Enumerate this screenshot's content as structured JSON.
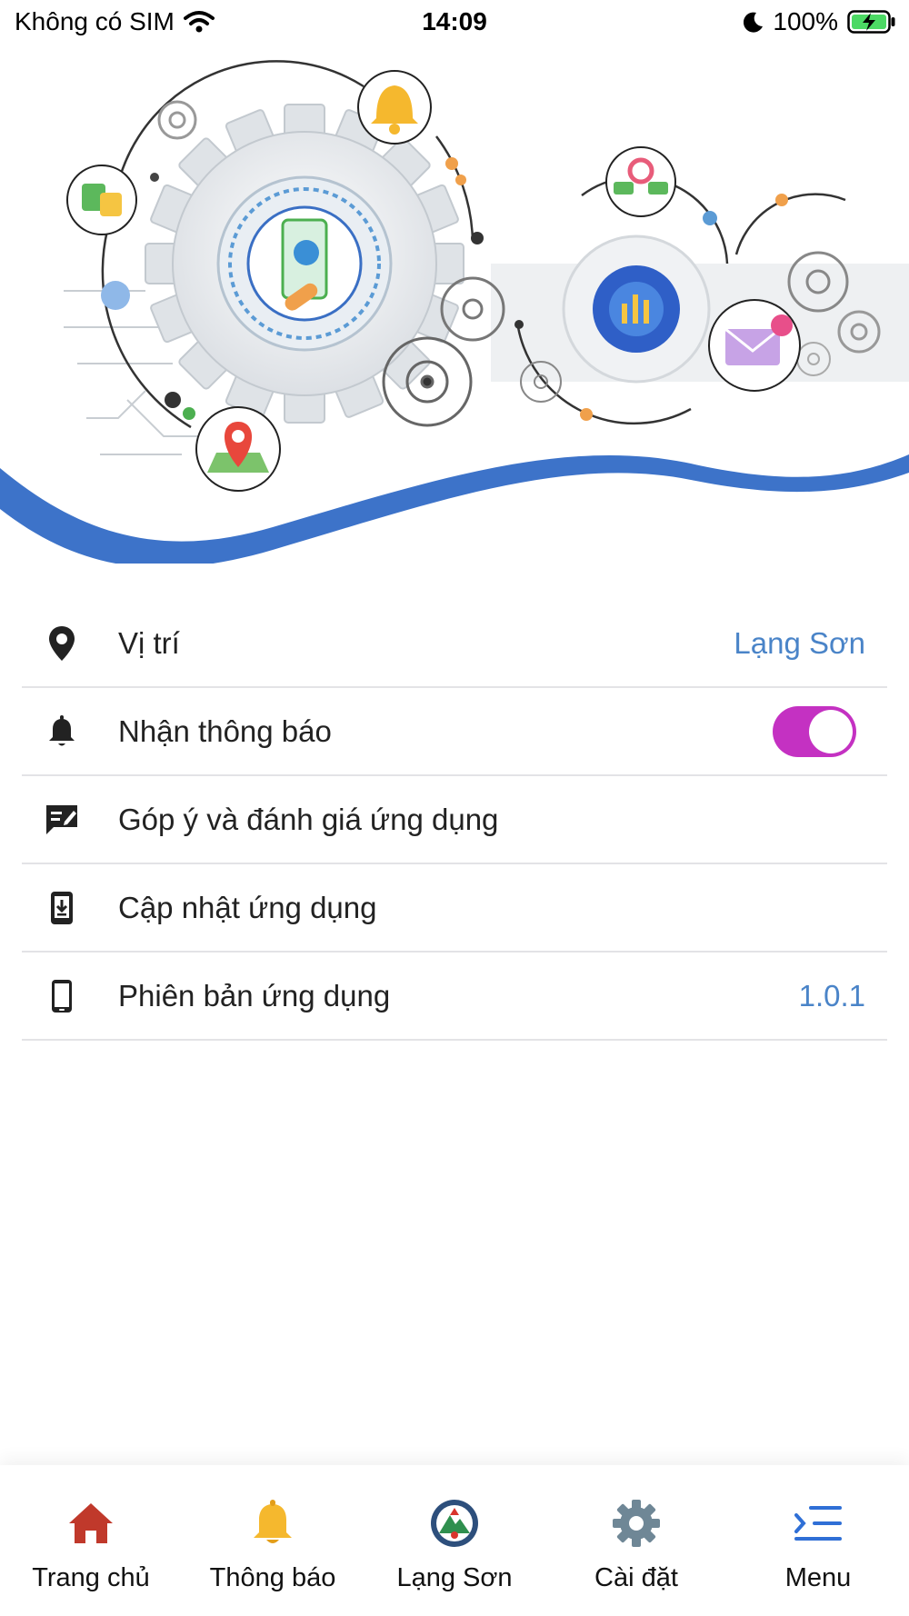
{
  "status_bar": {
    "carrier": "Không có SIM",
    "time": "14:09",
    "battery": "100%"
  },
  "settings": {
    "items": [
      {
        "label": "Vị trí",
        "value": "Lạng Sơn",
        "icon": "location-pin-icon"
      },
      {
        "label": "Nhận thông báo",
        "toggle_on": true,
        "icon": "bell-icon"
      },
      {
        "label": "Góp ý và đánh giá ứng dụng",
        "icon": "feedback-icon"
      },
      {
        "label": "Cập nhật ứng dụng",
        "icon": "download-update-icon"
      },
      {
        "label": "Phiên bản ứng dụng",
        "value": "1.0.1",
        "icon": "phone-icon"
      }
    ]
  },
  "tab_bar": {
    "items": [
      {
        "label": "Trang chủ",
        "icon": "home-icon"
      },
      {
        "label": "Thông báo",
        "icon": "bell-icon"
      },
      {
        "label": "Lạng Sơn",
        "icon": "emblem-icon"
      },
      {
        "label": "Cài đặt",
        "icon": "gear-icon"
      },
      {
        "label": "Menu",
        "icon": "menu-icon"
      }
    ]
  },
  "colors": {
    "accent_blue": "#4a84c8",
    "toggle_on": "#c431c2",
    "wave_blue": "#3d73c9",
    "home_red": "#c0392b",
    "bell_yellow": "#f5b82e",
    "gear_grey": "#6f8796",
    "menu_blue": "#2f6fd6"
  }
}
